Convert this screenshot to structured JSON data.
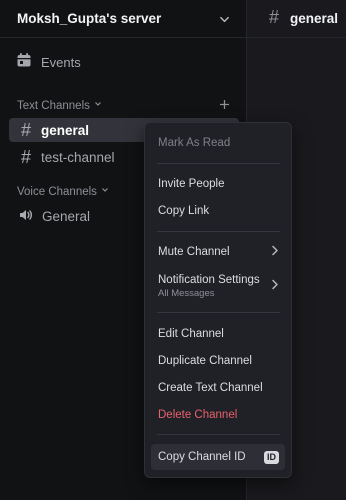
{
  "server": {
    "name": "Moksh_Gupta's server"
  },
  "sidebar": {
    "events_label": "Events",
    "text_category": "Text Channels",
    "voice_category": "Voice Channels",
    "channels": [
      {
        "name": "general",
        "selected": true
      },
      {
        "name": "test-channel",
        "selected": false
      }
    ],
    "voice_channels": [
      {
        "name": "General"
      }
    ]
  },
  "main": {
    "channel_title": "general"
  },
  "context_menu": {
    "mark_as_read": "Mark As Read",
    "invite_people": "Invite People",
    "copy_link": "Copy Link",
    "mute_channel": "Mute Channel",
    "notification_settings": "Notification Settings",
    "notification_settings_value": "All Messages",
    "edit_channel": "Edit Channel",
    "duplicate_channel": "Duplicate Channel",
    "create_text_channel": "Create Text Channel",
    "delete_channel": "Delete Channel",
    "copy_channel_id": "Copy Channel ID",
    "id_badge": "ID"
  },
  "colors": {
    "sidebar_bg": "#111214",
    "menu_bg": "#202127",
    "danger": "#e8616b",
    "selected_channel_bg": "#33343b"
  },
  "icons": {
    "events": "calendar-icon",
    "text_channel": "hash-icon",
    "voice_channel": "speaker-icon",
    "server_menu": "chevron-down-icon",
    "add": "plus-icon",
    "submenu": "chevron-right-icon"
  }
}
